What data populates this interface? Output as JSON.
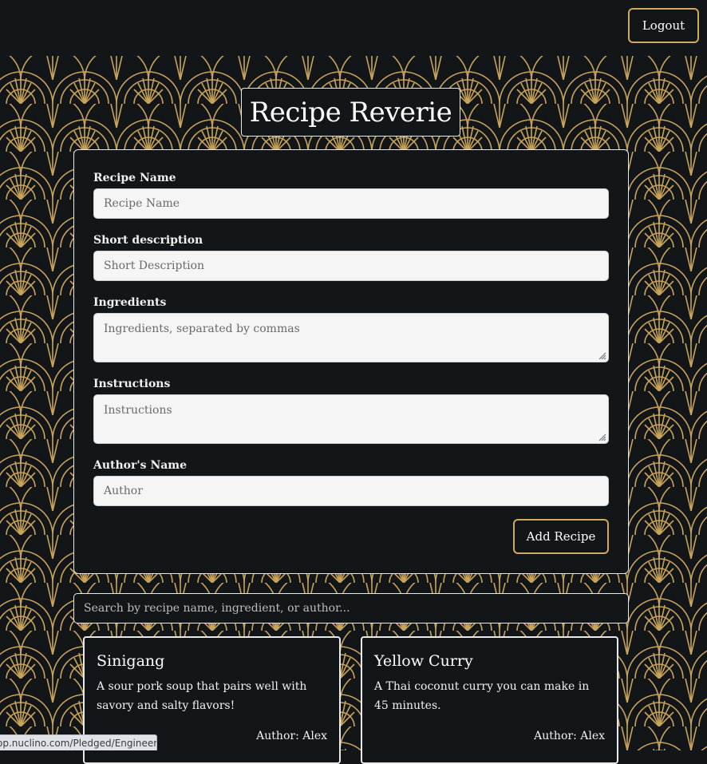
{
  "header": {
    "logout_label": "Logout"
  },
  "app": {
    "title": "Recipe Reverie"
  },
  "form": {
    "name": {
      "label": "Recipe Name",
      "placeholder": "Recipe Name",
      "value": ""
    },
    "description": {
      "label": "Short description",
      "placeholder": "Short Description",
      "value": ""
    },
    "ingredients": {
      "label": "Ingredients",
      "placeholder": "Ingredients, separated by commas",
      "value": ""
    },
    "instructions": {
      "label": "Instructions",
      "placeholder": "Instructions",
      "value": ""
    },
    "author": {
      "label": "Author's Name",
      "placeholder": "Author",
      "value": ""
    },
    "submit_label": "Add Recipe"
  },
  "search": {
    "placeholder": "Search by recipe name, ingredient, or author..."
  },
  "recipes": [
    {
      "name": "Sinigang",
      "description": "A sour pork soup that pairs well with savory and salty flavors!",
      "author": "Author: Alex"
    },
    {
      "name": "Yellow Curry",
      "description": "A Thai coconut curry you can make in 45 minutes.",
      "author": "Author: Alex"
    }
  ],
  "status_bar": {
    "url": "op.nuclino.com/Pledged/Engineering"
  },
  "colors": {
    "background": "#131619",
    "accent_gold": "#cfa95c",
    "card_border": "#e9e9e9",
    "input_bg": "#f5f5f5"
  }
}
